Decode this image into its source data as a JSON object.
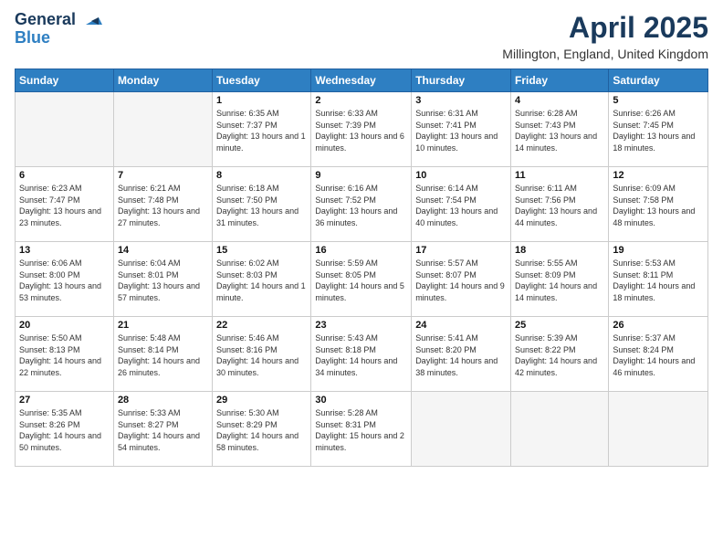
{
  "header": {
    "logo_general": "General",
    "logo_blue": "Blue",
    "month_title": "April 2025",
    "location": "Millington, England, United Kingdom"
  },
  "days_of_week": [
    "Sunday",
    "Monday",
    "Tuesday",
    "Wednesday",
    "Thursday",
    "Friday",
    "Saturday"
  ],
  "weeks": [
    [
      {
        "day": "",
        "info": ""
      },
      {
        "day": "",
        "info": ""
      },
      {
        "day": "1",
        "info": "Sunrise: 6:35 AM\nSunset: 7:37 PM\nDaylight: 13 hours and 1 minute."
      },
      {
        "day": "2",
        "info": "Sunrise: 6:33 AM\nSunset: 7:39 PM\nDaylight: 13 hours and 6 minutes."
      },
      {
        "day": "3",
        "info": "Sunrise: 6:31 AM\nSunset: 7:41 PM\nDaylight: 13 hours and 10 minutes."
      },
      {
        "day": "4",
        "info": "Sunrise: 6:28 AM\nSunset: 7:43 PM\nDaylight: 13 hours and 14 minutes."
      },
      {
        "day": "5",
        "info": "Sunrise: 6:26 AM\nSunset: 7:45 PM\nDaylight: 13 hours and 18 minutes."
      }
    ],
    [
      {
        "day": "6",
        "info": "Sunrise: 6:23 AM\nSunset: 7:47 PM\nDaylight: 13 hours and 23 minutes."
      },
      {
        "day": "7",
        "info": "Sunrise: 6:21 AM\nSunset: 7:48 PM\nDaylight: 13 hours and 27 minutes."
      },
      {
        "day": "8",
        "info": "Sunrise: 6:18 AM\nSunset: 7:50 PM\nDaylight: 13 hours and 31 minutes."
      },
      {
        "day": "9",
        "info": "Sunrise: 6:16 AM\nSunset: 7:52 PM\nDaylight: 13 hours and 36 minutes."
      },
      {
        "day": "10",
        "info": "Sunrise: 6:14 AM\nSunset: 7:54 PM\nDaylight: 13 hours and 40 minutes."
      },
      {
        "day": "11",
        "info": "Sunrise: 6:11 AM\nSunset: 7:56 PM\nDaylight: 13 hours and 44 minutes."
      },
      {
        "day": "12",
        "info": "Sunrise: 6:09 AM\nSunset: 7:58 PM\nDaylight: 13 hours and 48 minutes."
      }
    ],
    [
      {
        "day": "13",
        "info": "Sunrise: 6:06 AM\nSunset: 8:00 PM\nDaylight: 13 hours and 53 minutes."
      },
      {
        "day": "14",
        "info": "Sunrise: 6:04 AM\nSunset: 8:01 PM\nDaylight: 13 hours and 57 minutes."
      },
      {
        "day": "15",
        "info": "Sunrise: 6:02 AM\nSunset: 8:03 PM\nDaylight: 14 hours and 1 minute."
      },
      {
        "day": "16",
        "info": "Sunrise: 5:59 AM\nSunset: 8:05 PM\nDaylight: 14 hours and 5 minutes."
      },
      {
        "day": "17",
        "info": "Sunrise: 5:57 AM\nSunset: 8:07 PM\nDaylight: 14 hours and 9 minutes."
      },
      {
        "day": "18",
        "info": "Sunrise: 5:55 AM\nSunset: 8:09 PM\nDaylight: 14 hours and 14 minutes."
      },
      {
        "day": "19",
        "info": "Sunrise: 5:53 AM\nSunset: 8:11 PM\nDaylight: 14 hours and 18 minutes."
      }
    ],
    [
      {
        "day": "20",
        "info": "Sunrise: 5:50 AM\nSunset: 8:13 PM\nDaylight: 14 hours and 22 minutes."
      },
      {
        "day": "21",
        "info": "Sunrise: 5:48 AM\nSunset: 8:14 PM\nDaylight: 14 hours and 26 minutes."
      },
      {
        "day": "22",
        "info": "Sunrise: 5:46 AM\nSunset: 8:16 PM\nDaylight: 14 hours and 30 minutes."
      },
      {
        "day": "23",
        "info": "Sunrise: 5:43 AM\nSunset: 8:18 PM\nDaylight: 14 hours and 34 minutes."
      },
      {
        "day": "24",
        "info": "Sunrise: 5:41 AM\nSunset: 8:20 PM\nDaylight: 14 hours and 38 minutes."
      },
      {
        "day": "25",
        "info": "Sunrise: 5:39 AM\nSunset: 8:22 PM\nDaylight: 14 hours and 42 minutes."
      },
      {
        "day": "26",
        "info": "Sunrise: 5:37 AM\nSunset: 8:24 PM\nDaylight: 14 hours and 46 minutes."
      }
    ],
    [
      {
        "day": "27",
        "info": "Sunrise: 5:35 AM\nSunset: 8:26 PM\nDaylight: 14 hours and 50 minutes."
      },
      {
        "day": "28",
        "info": "Sunrise: 5:33 AM\nSunset: 8:27 PM\nDaylight: 14 hours and 54 minutes."
      },
      {
        "day": "29",
        "info": "Sunrise: 5:30 AM\nSunset: 8:29 PM\nDaylight: 14 hours and 58 minutes."
      },
      {
        "day": "30",
        "info": "Sunrise: 5:28 AM\nSunset: 8:31 PM\nDaylight: 15 hours and 2 minutes."
      },
      {
        "day": "",
        "info": ""
      },
      {
        "day": "",
        "info": ""
      },
      {
        "day": "",
        "info": ""
      }
    ]
  ]
}
